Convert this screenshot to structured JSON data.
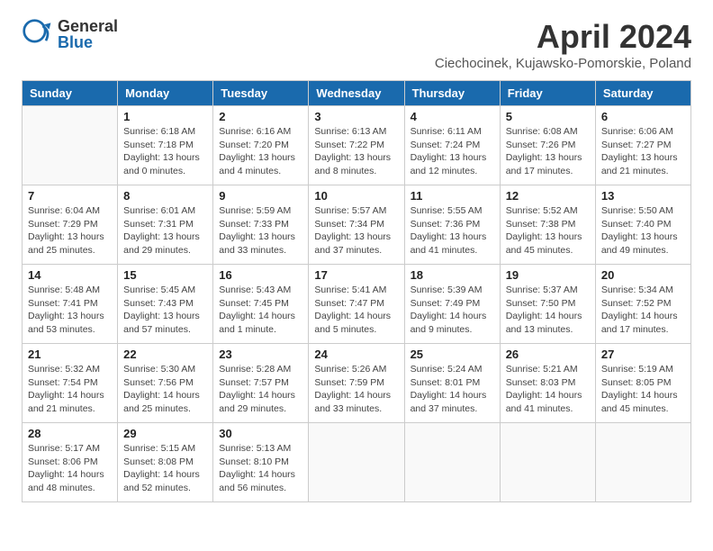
{
  "header": {
    "logo_general": "General",
    "logo_blue": "Blue",
    "month_title": "April 2024",
    "location": "Ciechocinek, Kujawsko-Pomorskie, Poland"
  },
  "days_of_week": [
    "Sunday",
    "Monday",
    "Tuesday",
    "Wednesday",
    "Thursday",
    "Friday",
    "Saturday"
  ],
  "weeks": [
    [
      {
        "day": "",
        "info": ""
      },
      {
        "day": "1",
        "info": "Sunrise: 6:18 AM\nSunset: 7:18 PM\nDaylight: 13 hours\nand 0 minutes."
      },
      {
        "day": "2",
        "info": "Sunrise: 6:16 AM\nSunset: 7:20 PM\nDaylight: 13 hours\nand 4 minutes."
      },
      {
        "day": "3",
        "info": "Sunrise: 6:13 AM\nSunset: 7:22 PM\nDaylight: 13 hours\nand 8 minutes."
      },
      {
        "day": "4",
        "info": "Sunrise: 6:11 AM\nSunset: 7:24 PM\nDaylight: 13 hours\nand 12 minutes."
      },
      {
        "day": "5",
        "info": "Sunrise: 6:08 AM\nSunset: 7:26 PM\nDaylight: 13 hours\nand 17 minutes."
      },
      {
        "day": "6",
        "info": "Sunrise: 6:06 AM\nSunset: 7:27 PM\nDaylight: 13 hours\nand 21 minutes."
      }
    ],
    [
      {
        "day": "7",
        "info": "Sunrise: 6:04 AM\nSunset: 7:29 PM\nDaylight: 13 hours\nand 25 minutes."
      },
      {
        "day": "8",
        "info": "Sunrise: 6:01 AM\nSunset: 7:31 PM\nDaylight: 13 hours\nand 29 minutes."
      },
      {
        "day": "9",
        "info": "Sunrise: 5:59 AM\nSunset: 7:33 PM\nDaylight: 13 hours\nand 33 minutes."
      },
      {
        "day": "10",
        "info": "Sunrise: 5:57 AM\nSunset: 7:34 PM\nDaylight: 13 hours\nand 37 minutes."
      },
      {
        "day": "11",
        "info": "Sunrise: 5:55 AM\nSunset: 7:36 PM\nDaylight: 13 hours\nand 41 minutes."
      },
      {
        "day": "12",
        "info": "Sunrise: 5:52 AM\nSunset: 7:38 PM\nDaylight: 13 hours\nand 45 minutes."
      },
      {
        "day": "13",
        "info": "Sunrise: 5:50 AM\nSunset: 7:40 PM\nDaylight: 13 hours\nand 49 minutes."
      }
    ],
    [
      {
        "day": "14",
        "info": "Sunrise: 5:48 AM\nSunset: 7:41 PM\nDaylight: 13 hours\nand 53 minutes."
      },
      {
        "day": "15",
        "info": "Sunrise: 5:45 AM\nSunset: 7:43 PM\nDaylight: 13 hours\nand 57 minutes."
      },
      {
        "day": "16",
        "info": "Sunrise: 5:43 AM\nSunset: 7:45 PM\nDaylight: 14 hours\nand 1 minute."
      },
      {
        "day": "17",
        "info": "Sunrise: 5:41 AM\nSunset: 7:47 PM\nDaylight: 14 hours\nand 5 minutes."
      },
      {
        "day": "18",
        "info": "Sunrise: 5:39 AM\nSunset: 7:49 PM\nDaylight: 14 hours\nand 9 minutes."
      },
      {
        "day": "19",
        "info": "Sunrise: 5:37 AM\nSunset: 7:50 PM\nDaylight: 14 hours\nand 13 minutes."
      },
      {
        "day": "20",
        "info": "Sunrise: 5:34 AM\nSunset: 7:52 PM\nDaylight: 14 hours\nand 17 minutes."
      }
    ],
    [
      {
        "day": "21",
        "info": "Sunrise: 5:32 AM\nSunset: 7:54 PM\nDaylight: 14 hours\nand 21 minutes."
      },
      {
        "day": "22",
        "info": "Sunrise: 5:30 AM\nSunset: 7:56 PM\nDaylight: 14 hours\nand 25 minutes."
      },
      {
        "day": "23",
        "info": "Sunrise: 5:28 AM\nSunset: 7:57 PM\nDaylight: 14 hours\nand 29 minutes."
      },
      {
        "day": "24",
        "info": "Sunrise: 5:26 AM\nSunset: 7:59 PM\nDaylight: 14 hours\nand 33 minutes."
      },
      {
        "day": "25",
        "info": "Sunrise: 5:24 AM\nSunset: 8:01 PM\nDaylight: 14 hours\nand 37 minutes."
      },
      {
        "day": "26",
        "info": "Sunrise: 5:21 AM\nSunset: 8:03 PM\nDaylight: 14 hours\nand 41 minutes."
      },
      {
        "day": "27",
        "info": "Sunrise: 5:19 AM\nSunset: 8:05 PM\nDaylight: 14 hours\nand 45 minutes."
      }
    ],
    [
      {
        "day": "28",
        "info": "Sunrise: 5:17 AM\nSunset: 8:06 PM\nDaylight: 14 hours\nand 48 minutes."
      },
      {
        "day": "29",
        "info": "Sunrise: 5:15 AM\nSunset: 8:08 PM\nDaylight: 14 hours\nand 52 minutes."
      },
      {
        "day": "30",
        "info": "Sunrise: 5:13 AM\nSunset: 8:10 PM\nDaylight: 14 hours\nand 56 minutes."
      },
      {
        "day": "",
        "info": ""
      },
      {
        "day": "",
        "info": ""
      },
      {
        "day": "",
        "info": ""
      },
      {
        "day": "",
        "info": ""
      }
    ]
  ]
}
